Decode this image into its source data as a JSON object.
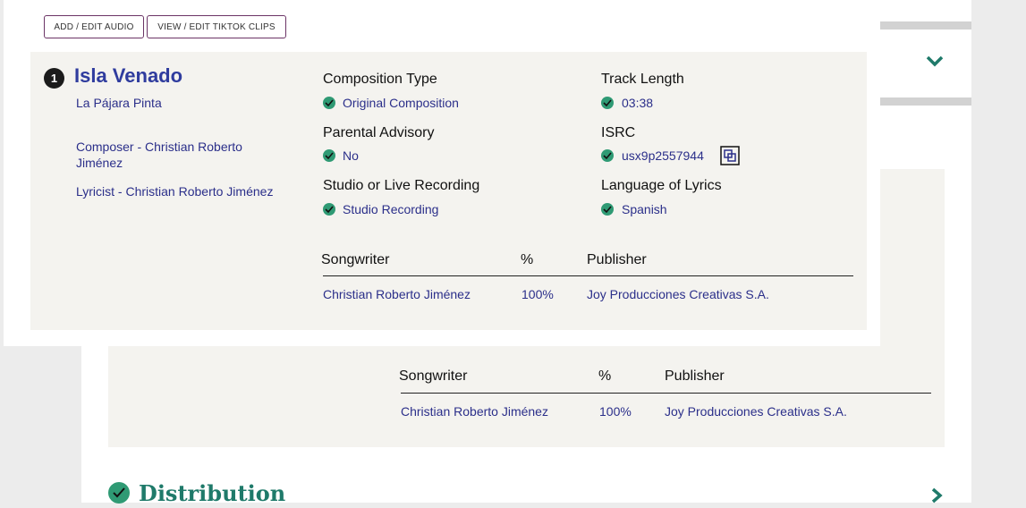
{
  "toolbar": {
    "add_audio_label": "ADD / EDIT AUDIO",
    "tiktok_label": "VIEW / EDIT TIKTOK CLIPS"
  },
  "track": {
    "number": "1",
    "title": "Isla Venado",
    "artist": "La Pájara Pinta",
    "composer": "Composer - Christian Roberto Jiménez",
    "lyricist": "Lyricist - Christian Roberto Jiménez",
    "fields": {
      "composition_type": {
        "label": "Composition Type",
        "value": "Original Composition"
      },
      "parental_advisory": {
        "label": "Parental Advisory",
        "value": "No"
      },
      "recording": {
        "label": "Studio or Live Recording",
        "value": "Studio Recording"
      },
      "track_length": {
        "label": "Track Length",
        "value": "03:38"
      },
      "isrc": {
        "label": "ISRC",
        "value": "usx9p2557944"
      },
      "language": {
        "label": "Language of Lyrics",
        "value": "Spanish"
      }
    },
    "splits": {
      "headers": {
        "songwriter": "Songwriter",
        "percent": "%",
        "publisher": "Publisher"
      },
      "rows": [
        {
          "songwriter": "Christian Roberto Jiménez",
          "percent": "100%",
          "publisher": "Joy Producciones Creativas S.A."
        }
      ]
    }
  },
  "background_splits": {
    "headers": {
      "songwriter": "Songwriter",
      "percent": "%",
      "publisher": "Publisher"
    },
    "rows": [
      {
        "songwriter": "Christian Roberto Jiménez",
        "percent": "100%",
        "publisher": "Joy Producciones Creativas S.A."
      }
    ]
  },
  "distribution": {
    "title": "Distribution"
  },
  "colors": {
    "accent_green": "#2f9a74",
    "title_blue": "#2f3c9e",
    "button_border": "#6b3466"
  }
}
